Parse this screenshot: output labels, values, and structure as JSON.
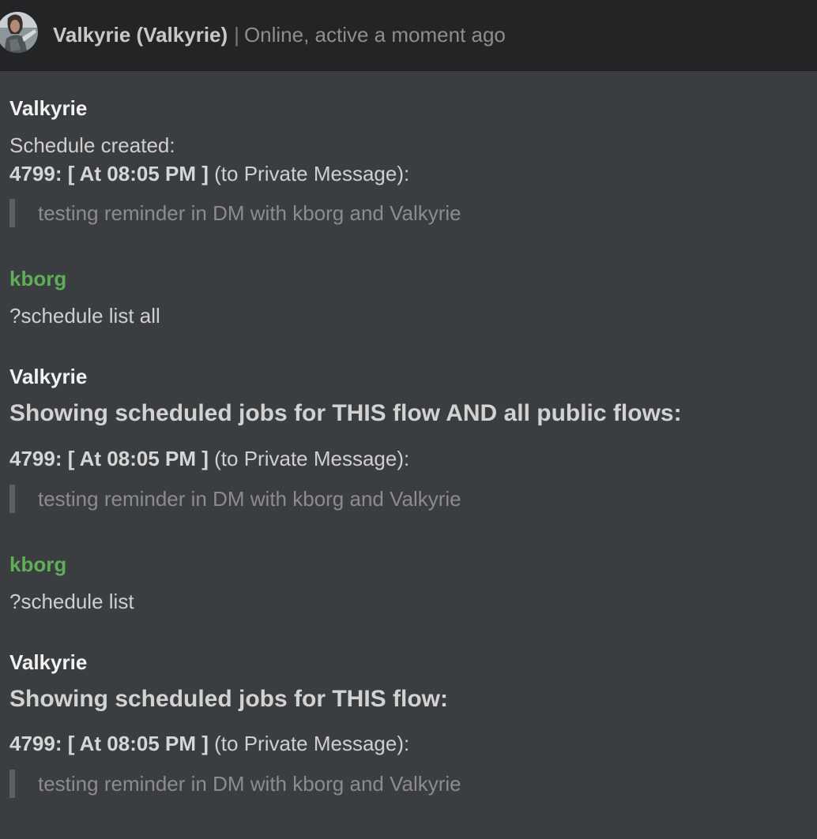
{
  "header": {
    "contact_name": "Valkyrie (Valkyrie)",
    "separator": "|",
    "status": "Online, active a moment ago",
    "avatar_icon": "user-avatar"
  },
  "messages": [
    {
      "author": "Valkyrie",
      "intro": "Schedule created:",
      "job_id_time": "4799: [ At 08:05 PM ]",
      "target": "(to Private Message):",
      "quote": "testing reminder in DM with kborg and Valkyrie"
    },
    {
      "author": "kborg",
      "text": "?schedule list all"
    },
    {
      "author": "Valkyrie",
      "heading": "Showing scheduled jobs for THIS flow AND all public flows:",
      "job_id_time": "4799: [ At 08:05 PM ]",
      "target": "(to Private Message):",
      "quote": "testing reminder in DM with kborg and Valkyrie"
    },
    {
      "author": "kborg",
      "text": "?schedule list"
    },
    {
      "author": "Valkyrie",
      "heading": "Showing scheduled jobs for THIS flow:",
      "job_id_time": "4799: [ At 08:05 PM ]",
      "target": "(to Private Message):",
      "quote": "testing reminder in DM with kborg and Valkyrie"
    }
  ],
  "colors": {
    "header_bg": "#232426",
    "thread_bg": "#3b3e40",
    "bot_author": "#f2f2f2",
    "user_author": "#5fae58",
    "quote_bar": "#5d6063"
  }
}
